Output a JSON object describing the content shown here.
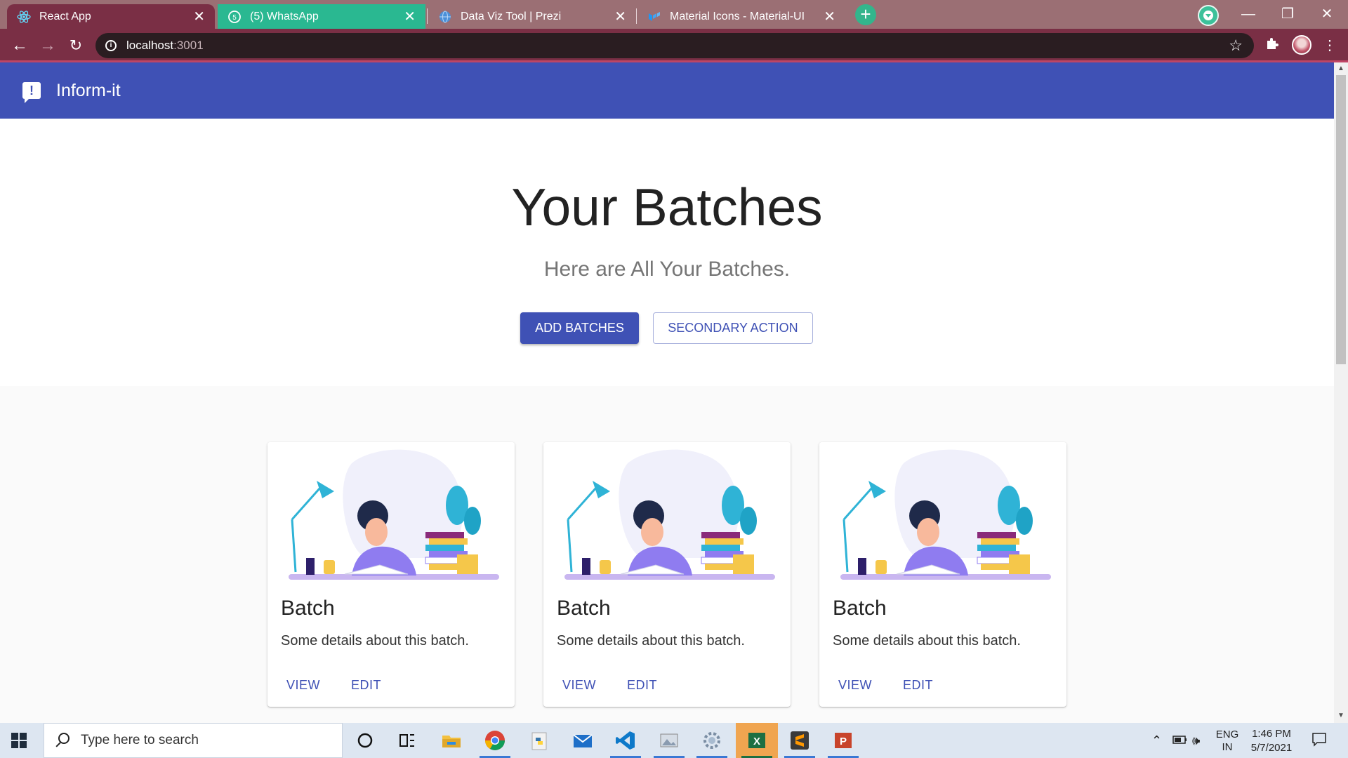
{
  "browser": {
    "tabs": [
      {
        "title": "React App",
        "active": true
      },
      {
        "title": "(5) WhatsApp",
        "active": false
      },
      {
        "title": "Data Viz Tool | Prezi",
        "active": false
      },
      {
        "title": "Material Icons - Material-UI",
        "active": false
      }
    ],
    "url_host": "localhost",
    "url_port": ":3001"
  },
  "app": {
    "brand": "Inform-it",
    "hero": {
      "title": "Your Batches",
      "subtitle": "Here are All Your Batches.",
      "primary_button": "ADD BATCHES",
      "secondary_button": "SECONDARY ACTION"
    },
    "cards": [
      {
        "title": "Batch",
        "description": "Some details about this batch.",
        "view_label": "VIEW",
        "edit_label": "EDIT"
      },
      {
        "title": "Batch",
        "description": "Some details about this batch.",
        "view_label": "VIEW",
        "edit_label": "EDIT"
      },
      {
        "title": "Batch",
        "description": "Some details about this batch.",
        "view_label": "VIEW",
        "edit_label": "EDIT"
      }
    ]
  },
  "taskbar": {
    "search_placeholder": "Type here to search",
    "language": "ENG",
    "region": "IN",
    "time": "1:46 PM",
    "date": "5/7/2021"
  },
  "colors": {
    "primary": "#3f51b5",
    "browser_frame": "#7a2f45",
    "whatsapp_tab": "#2ab891"
  }
}
